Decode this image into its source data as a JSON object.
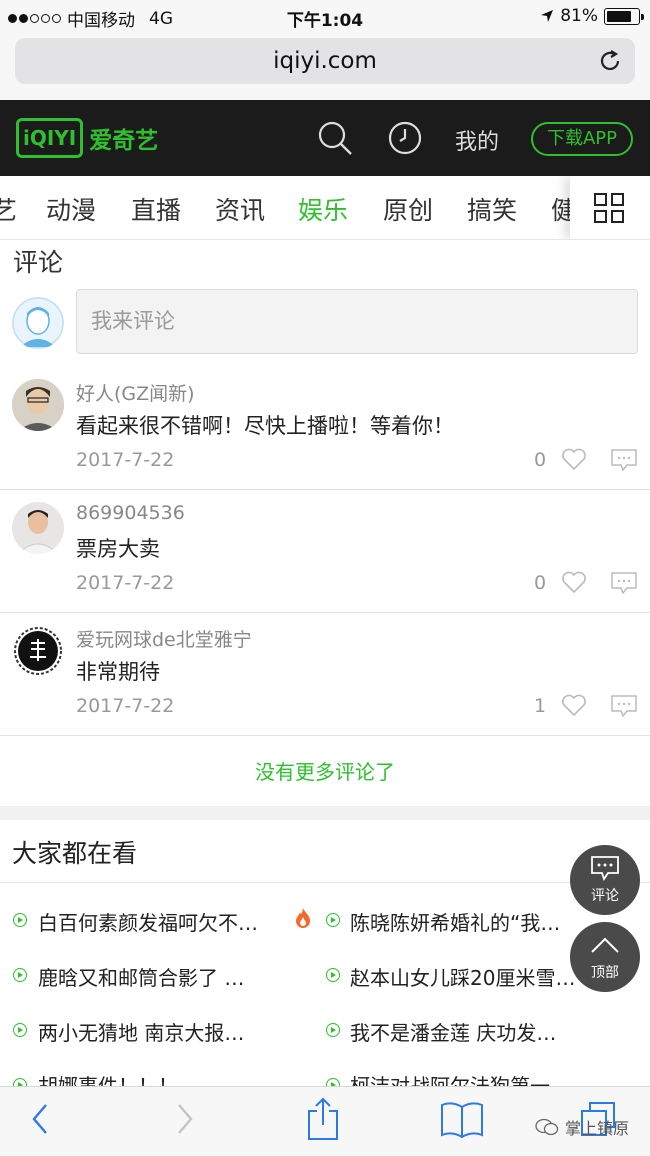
{
  "status": {
    "carrier": "中国移动",
    "network": "4G",
    "time": "下午1:04",
    "battery": "81%"
  },
  "browser": {
    "url": "iqiyi.com"
  },
  "header": {
    "logo_mark": "iQIYI",
    "logo_text": "爱奇艺",
    "mine": "我的",
    "download": "下载APP"
  },
  "categories": [
    "艺",
    "动漫",
    "直播",
    "资讯",
    "娱乐",
    "原创",
    "搞笑",
    "健"
  ],
  "active_category": "娱乐",
  "comments_section": {
    "title": "评论",
    "input_placeholder": "我来评论",
    "items": [
      {
        "user": "好人(GZ闻新)",
        "text": "看起来很不错啊！尽快上播啦！等着你！",
        "date": "2017-7-22",
        "likes": "0"
      },
      {
        "user": "869904536",
        "text": "票房大卖",
        "date": "2017-7-22",
        "likes": "0"
      },
      {
        "user": "爱玩网球de北堂雅宁",
        "text": "非常期待",
        "date": "2017-7-22",
        "likes": "1"
      }
    ],
    "no_more": "没有更多评论了"
  },
  "watching": {
    "title": "大家都在看",
    "items": [
      "白百何素颜发福呵欠不…",
      "陈晓陈妍希婚礼的“我…",
      "鹿晗又和邮筒合影了 …",
      "赵本山女儿踩20厘米雪…",
      "两小无猜地 南京大报…",
      "我不是潘金莲 庆功发…",
      "胡娜事件！！！",
      "柯洁对战阿尔法狗第一…"
    ]
  },
  "float": {
    "comment": "评论",
    "top": "顶部"
  },
  "watermark": "掌上镇原"
}
